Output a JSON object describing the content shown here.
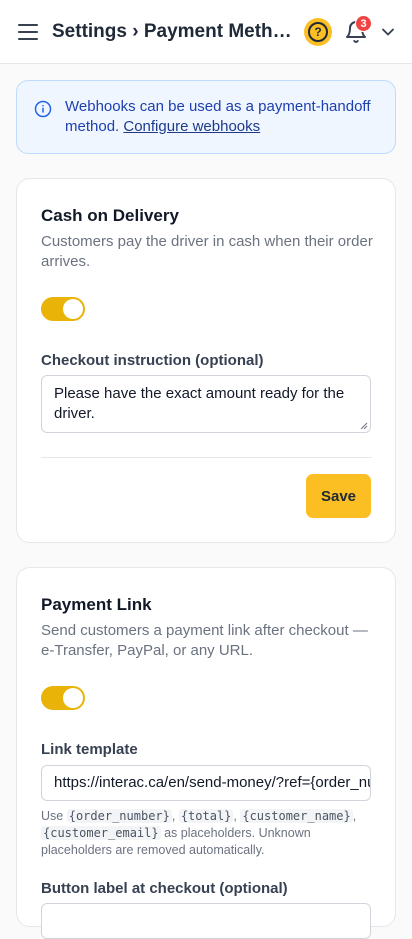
{
  "header": {
    "title": "Settings › Payment Methods",
    "notification_count": "3",
    "help_symbol": "?"
  },
  "notice": {
    "text": "Webhooks can be used as a payment-handoff method. ",
    "link": "Configure webhooks"
  },
  "cash_on_delivery": {
    "title": "Cash on Delivery",
    "description": "Customers pay the driver in cash when their order arrives.",
    "enabled": true,
    "instruction_label": "Checkout instruction (optional)",
    "instruction_value": "Please have the exact amount ready for the driver.",
    "save_label": "Save"
  },
  "payment_link": {
    "title": "Payment Link",
    "description": "Send customers a payment link after checkout — e-Transfer, PayPal, or any URL.",
    "enabled": true,
    "template_label": "Link template",
    "template_value": "https://interac.ca/en/send-money/?ref={order_number}",
    "help_prefix": "Use",
    "placeholders": [
      "{order_number}",
      "{total}",
      "{customer_name}",
      "{customer_email}"
    ],
    "help_suffix": "as placeholders. Unknown placeholders are removed automatically.",
    "button_label_label": "Button label at checkout (optional)"
  },
  "colors": {
    "accent": "#fbbf24",
    "toggle": "#eab308",
    "notice_bg": "#eff6ff",
    "badge": "#ef4444"
  },
  "icons": [
    "menu-icon",
    "help-icon",
    "bell-icon",
    "chevron-down-icon",
    "info-icon"
  ]
}
